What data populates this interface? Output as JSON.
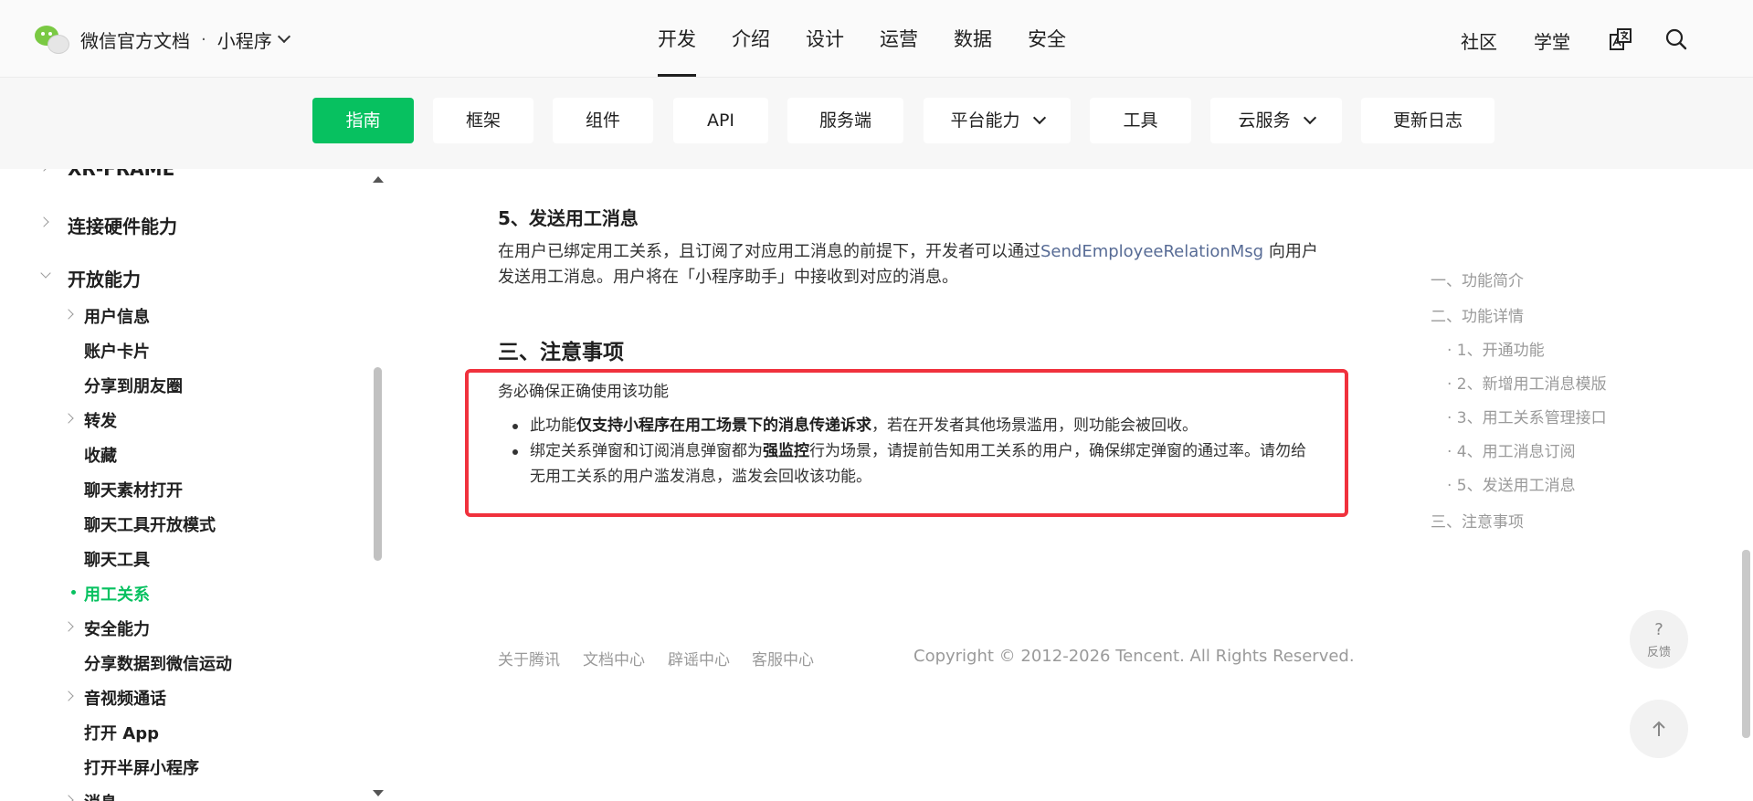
{
  "header": {
    "brand_title": "微信官方文档",
    "separator": "·",
    "product": "小程序",
    "nav": [
      "开发",
      "介绍",
      "设计",
      "运营",
      "数据",
      "安全"
    ],
    "active_nav": "开发",
    "right_links": [
      "社区",
      "学堂"
    ]
  },
  "subnav": {
    "items": [
      "指南",
      "框架",
      "组件",
      "API",
      "服务端",
      "平台能力",
      "工具",
      "云服务",
      "更新日志"
    ],
    "active": "指南"
  },
  "sidebar": {
    "items": [
      {
        "label": "XR-FRAME",
        "level": 1
      },
      {
        "label": "连接硬件能力",
        "level": 1
      },
      {
        "label": "开放能力",
        "level": 1,
        "expanded": true
      },
      {
        "label": "用户信息",
        "level": 2
      },
      {
        "label": "账户卡片",
        "level": 2
      },
      {
        "label": "分享到朋友圈",
        "level": 2
      },
      {
        "label": "转发",
        "level": 2
      },
      {
        "label": "收藏",
        "level": 2
      },
      {
        "label": "聊天素材打开",
        "level": 2
      },
      {
        "label": "聊天工具开放模式",
        "level": 2
      },
      {
        "label": "聊天工具",
        "level": 2
      },
      {
        "label": "用工关系",
        "level": 2,
        "active": true
      },
      {
        "label": "安全能力",
        "level": 2
      },
      {
        "label": "分享数据到微信运动",
        "level": 2
      },
      {
        "label": "音视频通话",
        "level": 2
      },
      {
        "label": "打开 App",
        "level": 2
      },
      {
        "label": "打开半屏小程序",
        "level": 2
      },
      {
        "label": "消息",
        "level": 2
      }
    ]
  },
  "content": {
    "section5_title": "5、发送用工消息",
    "section5_text_before": "在用户已绑定用工关系，且订阅了对应用工消息的前提下，开发者可以通过",
    "section5_link": "SendEmployeeRelationMsg",
    "section5_text_after": " 向用户发送用工消息。用户将在「小程序助手」中接收到对应的消息。",
    "notes_title": "三、注意事项",
    "notes_intro": "务必确保正确使用该功能",
    "bullet1_a": "此功能",
    "bullet1_bold": "仅支持小程序在用工场景下的消息传递诉求",
    "bullet1_b": "，若在开发者其他场景滥用，则功能会被回收。",
    "bullet2_a": "绑定关系弹窗和订阅消息弹窗都为",
    "bullet2_bold": "强监控",
    "bullet2_b": "行为场景，请提前告知用工关系的用户，确保绑定弹窗的通过率。请勿给无用工关系的用户滥发消息，滥发会回收该功能。"
  },
  "toc": {
    "items": [
      "一、功能简介",
      "二、功能详情",
      "· 1、开通功能",
      "· 2、新增用工消息模版",
      "· 3、用工关系管理接口",
      "· 4、用工消息订阅",
      "· 5、发送用工消息",
      "三、注意事项"
    ]
  },
  "footer": {
    "links": [
      "关于腾讯",
      "文档中心",
      "辟谣中心",
      "客服中心"
    ],
    "copyright": "Copyright © 2012-2026 Tencent. All Rights Reserved."
  },
  "floating": {
    "feedback_symbol": "?",
    "feedback_label": "反馈"
  },
  "colors": {
    "accent_green": "#07c160",
    "link_blue": "#576b95",
    "highlight_red": "#f0313d"
  },
  "icons": [
    "wechat-logo-icon",
    "chevron-down-icon",
    "translate-icon",
    "search-icon",
    "chevron-right-icon",
    "back-to-top-icon"
  ]
}
